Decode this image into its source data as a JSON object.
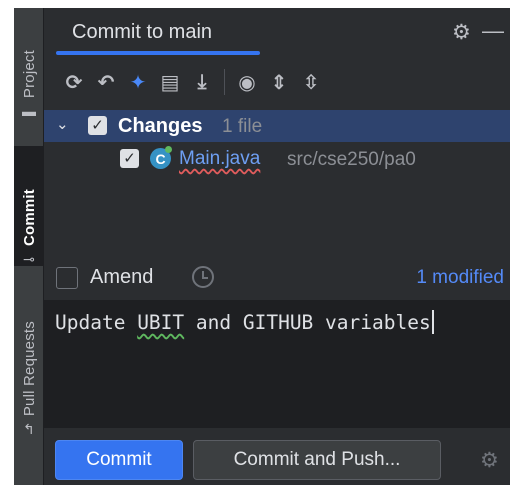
{
  "sidebar": {
    "tabs": [
      {
        "label": "Project",
        "icon": "folder-icon"
      },
      {
        "label": "Commit",
        "icon": "commit-icon"
      },
      {
        "label": "Pull Requests",
        "icon": "pull-request-icon"
      }
    ]
  },
  "header": {
    "title": "Commit to main",
    "settings_icon": "⚙",
    "minimize_icon": "—"
  },
  "toolbar": {
    "icons": [
      {
        "name": "refresh-icon",
        "glyph": "⟳"
      },
      {
        "name": "rollback-icon",
        "glyph": "↶"
      },
      {
        "name": "merge-icon",
        "glyph": "✦"
      },
      {
        "name": "diff-icon",
        "glyph": "▤"
      },
      {
        "name": "update-icon",
        "glyph": "⤓"
      },
      {
        "name": "view-options-icon",
        "glyph": "◉"
      },
      {
        "name": "expand-all-icon",
        "glyph": "⇕"
      },
      {
        "name": "collapse-all-icon",
        "glyph": "⇳"
      }
    ]
  },
  "changes": {
    "label": "Changes",
    "count": "1 file",
    "files": [
      {
        "name": "Main.java",
        "path": "src/cse250/pa0",
        "icon_letter": "C"
      }
    ]
  },
  "amend": {
    "label": "Amend",
    "modified": "1 modified"
  },
  "message": {
    "before": "Update ",
    "underlined": "UBIT",
    "after": " and GITHUB variables"
  },
  "buttons": {
    "commit": "Commit",
    "commit_push": "Commit and Push..."
  },
  "colors": {
    "accent": "#3574f0",
    "background": "#2b2d30",
    "selection": "#2e436e",
    "link": "#6e9ff3"
  }
}
